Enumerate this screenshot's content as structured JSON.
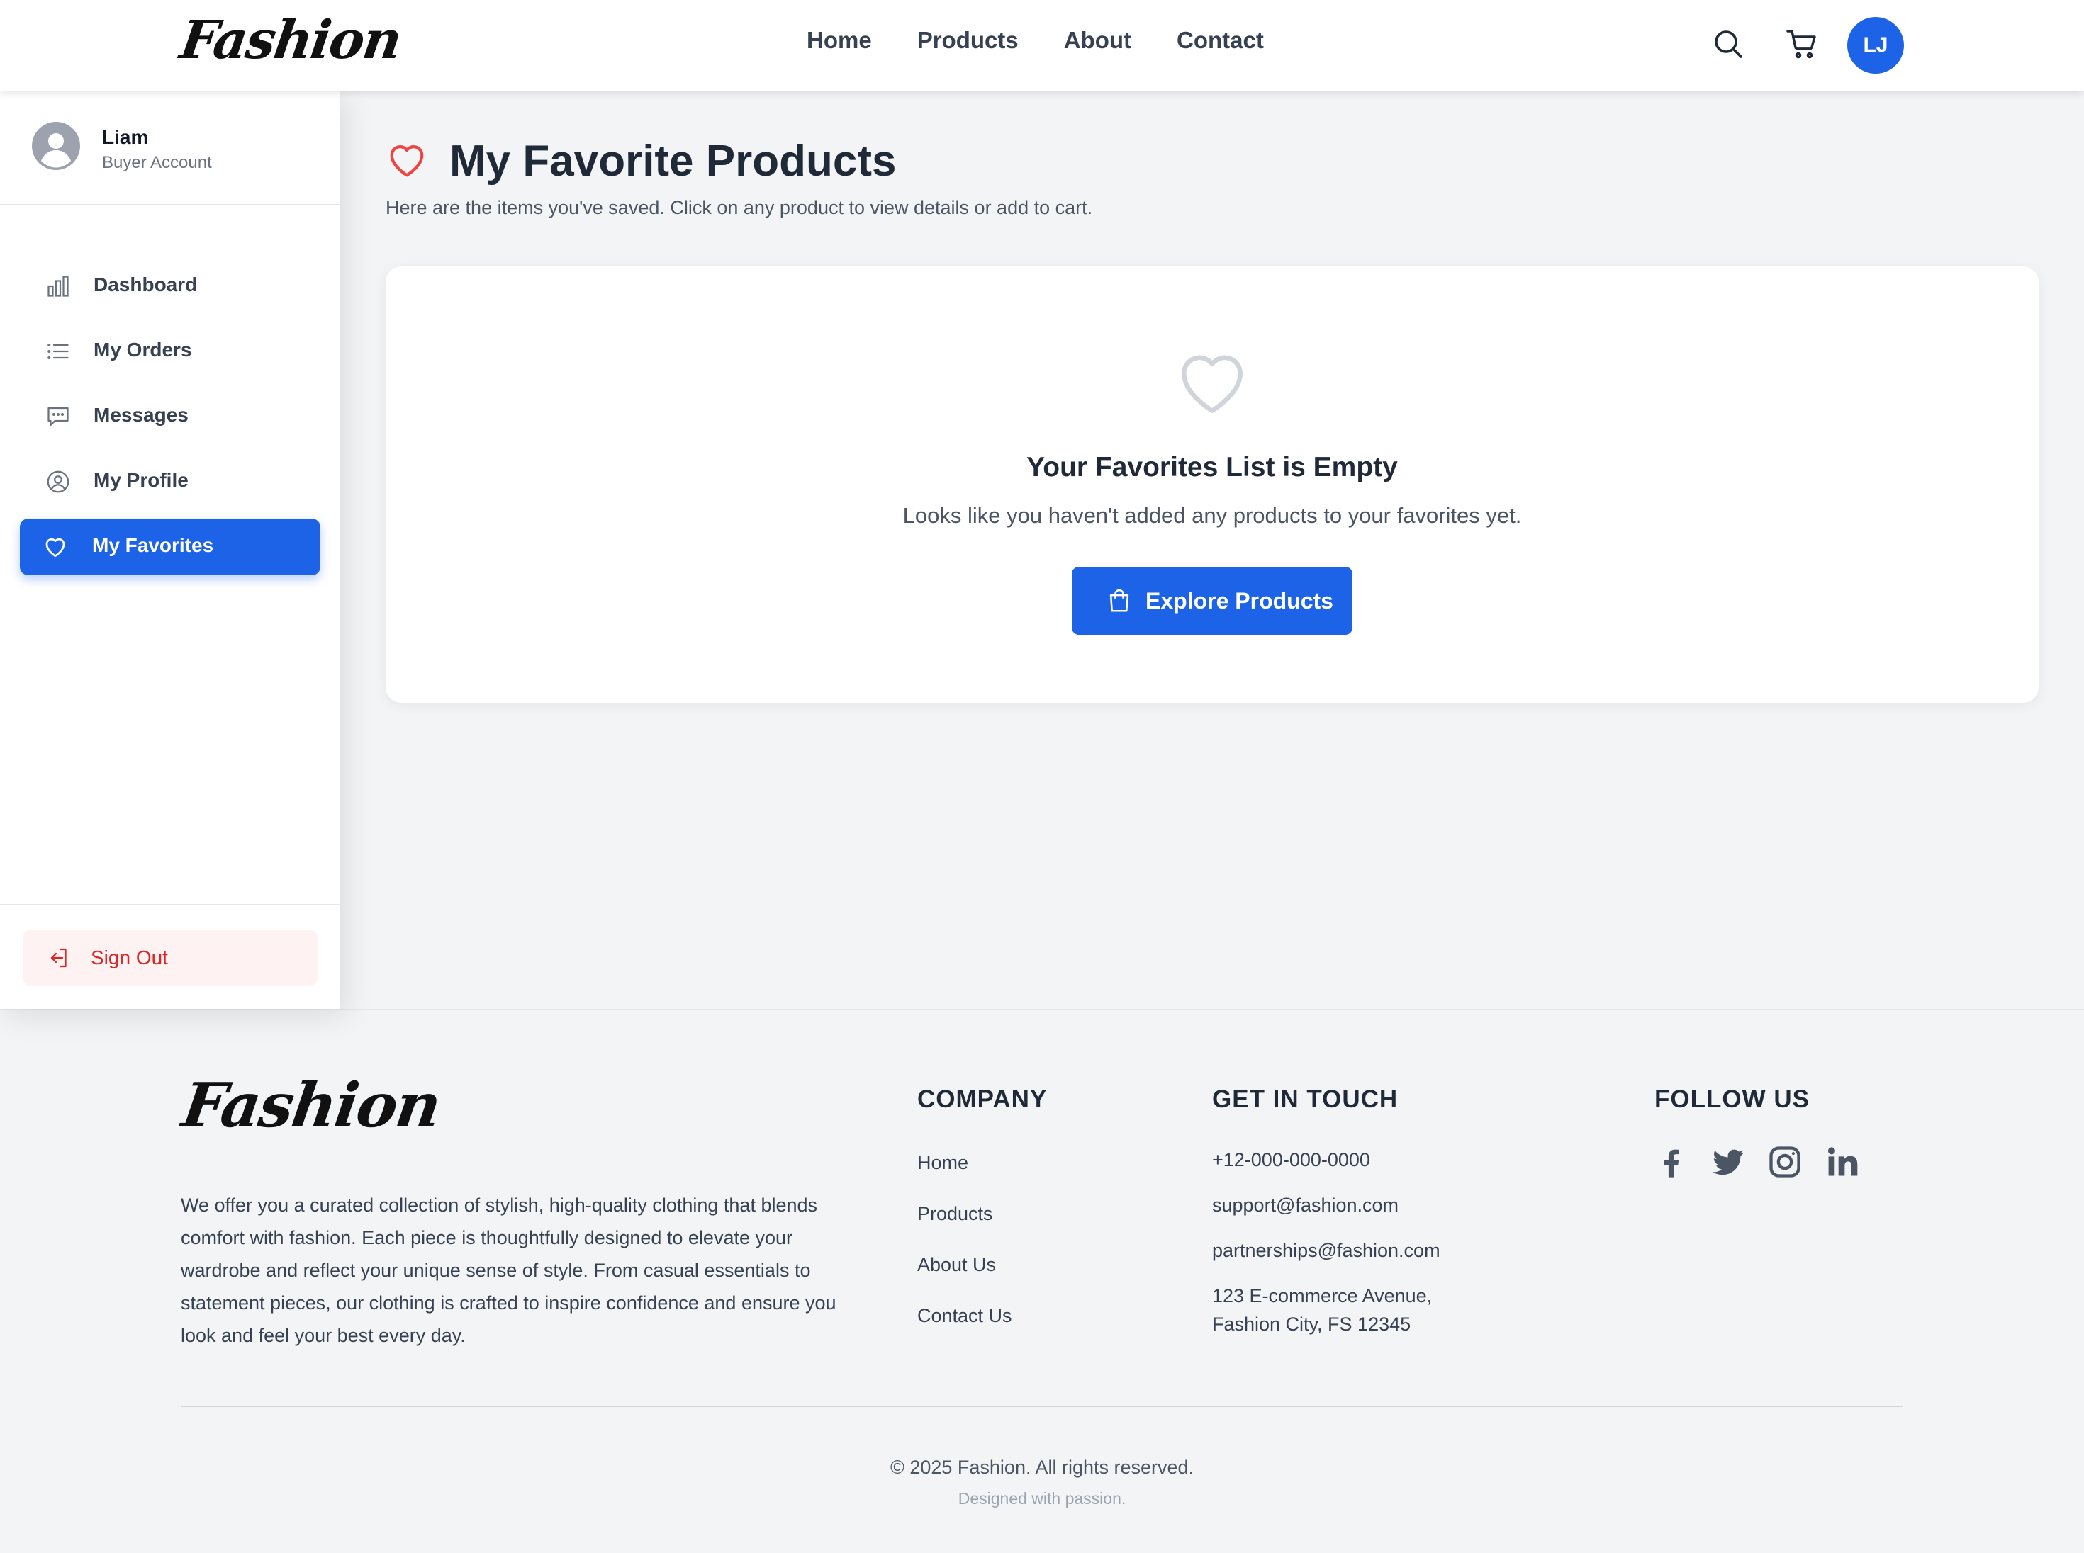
{
  "header": {
    "logo": "Fashion",
    "nav": [
      "Home",
      "Products",
      "About",
      "Contact"
    ],
    "avatar_initials": "LJ"
  },
  "sidebar": {
    "user": {
      "name": "Liam",
      "role": "Buyer Account"
    },
    "items": [
      {
        "label": "Dashboard",
        "icon": "bar-chart-icon"
      },
      {
        "label": "My Orders",
        "icon": "list-icon"
      },
      {
        "label": "Messages",
        "icon": "chat-icon"
      },
      {
        "label": "My Profile",
        "icon": "user-circle-icon"
      },
      {
        "label": "My Favorites",
        "icon": "heart-icon",
        "active": true
      }
    ],
    "signout_label": "Sign Out"
  },
  "main": {
    "title": "My Favorite Products",
    "subtitle": "Here are the items you've saved. Click on any product to view details or add to cart.",
    "empty": {
      "title": "Your Favorites List is Empty",
      "message": "Looks like you haven't added any products to your favorites yet.",
      "button_label": "Explore Products"
    }
  },
  "footer": {
    "logo": "Fashion",
    "about": "We offer you a curated collection of stylish, high-quality clothing that blends comfort with fashion. Each piece is thoughtfully designed to elevate your wardrobe and reflect your unique sense of style. From casual essentials to statement pieces, our clothing is crafted to inspire confidence and ensure you look and feel your best every day.",
    "company": {
      "heading": "COMPANY",
      "links": [
        "Home",
        "Products",
        "About Us",
        "Contact Us"
      ]
    },
    "contact": {
      "heading": "GET IN TOUCH",
      "phone": "+12-000-000-0000",
      "email_support": "support@fashion.com",
      "email_partners": "partnerships@fashion.com",
      "address_line1": "123 E-commerce Avenue,",
      "address_line2": "Fashion City, FS 12345"
    },
    "follow": {
      "heading": "FOLLOW US",
      "networks": [
        "facebook-icon",
        "twitter-icon",
        "instagram-icon",
        "linkedin-icon"
      ]
    },
    "copyright": "© 2025 Fashion. All rights reserved.",
    "tagline": "Designed with passion."
  },
  "colors": {
    "primary": "#1d63e8",
    "danger": "#dc2626",
    "heart_red": "#ef4444",
    "background": "#f3f4f6"
  }
}
